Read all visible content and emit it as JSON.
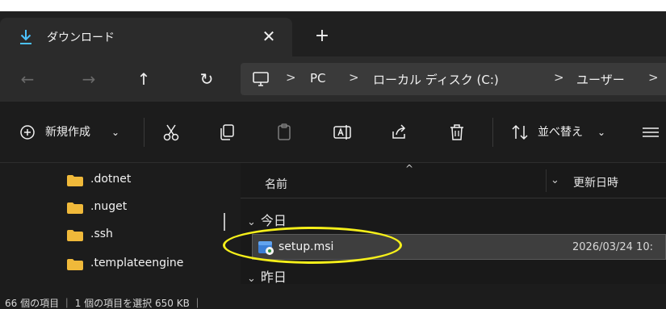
{
  "tab": {
    "title": "ダウンロード",
    "close_label": "✕",
    "new_label": "+"
  },
  "nav": {
    "back_label": "←",
    "forward_label": "→",
    "up_label": "↑",
    "refresh_label": "↻"
  },
  "address": {
    "separator": ">",
    "crumbs": [
      "PC",
      "ローカル ディスク (C:)",
      "ユーザー"
    ]
  },
  "toolbar": {
    "new_label": "新規作成",
    "new_chevron": "⌄",
    "sort_label": "並べ替え",
    "sort_chevron": "⌄"
  },
  "sidebar": {
    "items": [
      {
        "label": ".dotnet"
      },
      {
        "label": ".nuget"
      },
      {
        "label": ".ssh"
      },
      {
        "label": ".templateengine"
      }
    ]
  },
  "columns": {
    "name": "名前",
    "sort_indicator": "^",
    "chevron": "⌄",
    "date_modified": "更新日時"
  },
  "groups": {
    "today": "今日",
    "yesterday": "昨日",
    "chevron": "⌄"
  },
  "files": [
    {
      "name": "setup.msi",
      "date": "2026/03/24 10:"
    }
  ],
  "status": {
    "text": "66 個の項目 ｜ 1 個の項目を選択 650 KB ｜"
  },
  "colors": {
    "accent": "#f5ef1a",
    "folder": "#f0b93a",
    "download_icon": "#4cc2ff"
  }
}
